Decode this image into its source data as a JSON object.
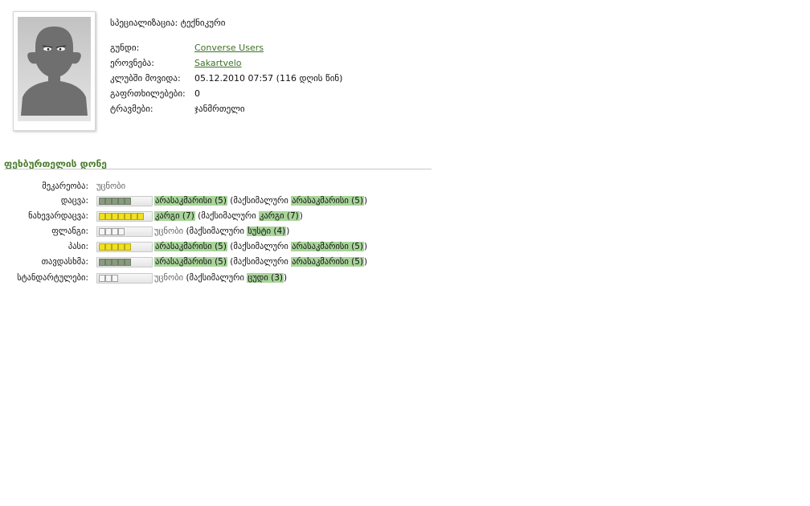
{
  "profile": {
    "specialization": "სპეციალიზაცია: ტექნიკური",
    "fields": [
      {
        "label": "გუნდი:",
        "value": "Converse Users",
        "link": true
      },
      {
        "label": "ეროვნება:",
        "value": "Sakartvelo",
        "link": true
      },
      {
        "label": "კლუბში მოვიდა:",
        "value": "05.12.2010 07:57 (116 დღის წინ)",
        "link": false
      },
      {
        "label": "გაფრთხილებები:",
        "value": "0",
        "link": false
      },
      {
        "label": "ტრავმები:",
        "value": "ჯანმრთელი",
        "link": false
      }
    ]
  },
  "skills_section": {
    "title": "ფეხბურთელის დონე",
    "rows": [
      {
        "label": "მეკარეობა:",
        "has_bar": false,
        "value": "უცნობი",
        "value_muted": true
      },
      {
        "label": "დაცვა:",
        "has_bar": true,
        "bar": "green",
        "filled": 5,
        "total": 5,
        "value": "არასაკმარისი (5)",
        "max_prefix": "(მაქსიმალური ",
        "max": "არასაკმარისი (5)",
        "max_suffix": ")"
      },
      {
        "label": "ნახევარდაცვა:",
        "has_bar": true,
        "bar": "yellow",
        "filled": 7,
        "total": 7,
        "value": "კარგი (7)",
        "max_prefix": "(მაქსიმალური ",
        "max": "კარგი (7)",
        "max_suffix": ")"
      },
      {
        "label": "ფლანგი:",
        "has_bar": true,
        "bar": "empty",
        "filled": 4,
        "total": 4,
        "value": "უცნობი",
        "value_muted": true,
        "max_prefix": "(მაქსიმალური ",
        "max": "სუსტი (4)",
        "max_suffix": ")"
      },
      {
        "label": "პასი:",
        "has_bar": true,
        "bar": "yellow",
        "filled": 5,
        "total": 5,
        "value": "არასაკმარისი (5)",
        "max_prefix": "(მაქსიმალური ",
        "max": "არასაკმარისი (5)",
        "max_suffix": ")"
      },
      {
        "label": "თავდასხმა:",
        "has_bar": true,
        "bar": "green",
        "filled": 5,
        "total": 5,
        "value": "არასაკმარისი (5)",
        "max_prefix": "(მაქსიმალური ",
        "max": "არასაკმარისი (5)",
        "max_suffix": ")"
      },
      {
        "label": "სტანდარტულები:",
        "has_bar": true,
        "bar": "empty",
        "filled": 3,
        "total": 3,
        "value": "უცნობი",
        "value_muted": true,
        "max_prefix": "(მაქსიმალური ",
        "max": "ცუდი (3)",
        "max_suffix": ")"
      }
    ]
  },
  "colors": {
    "link": "#3d7226",
    "section": "#4b7c2e",
    "highlight": "#a8d49a"
  }
}
